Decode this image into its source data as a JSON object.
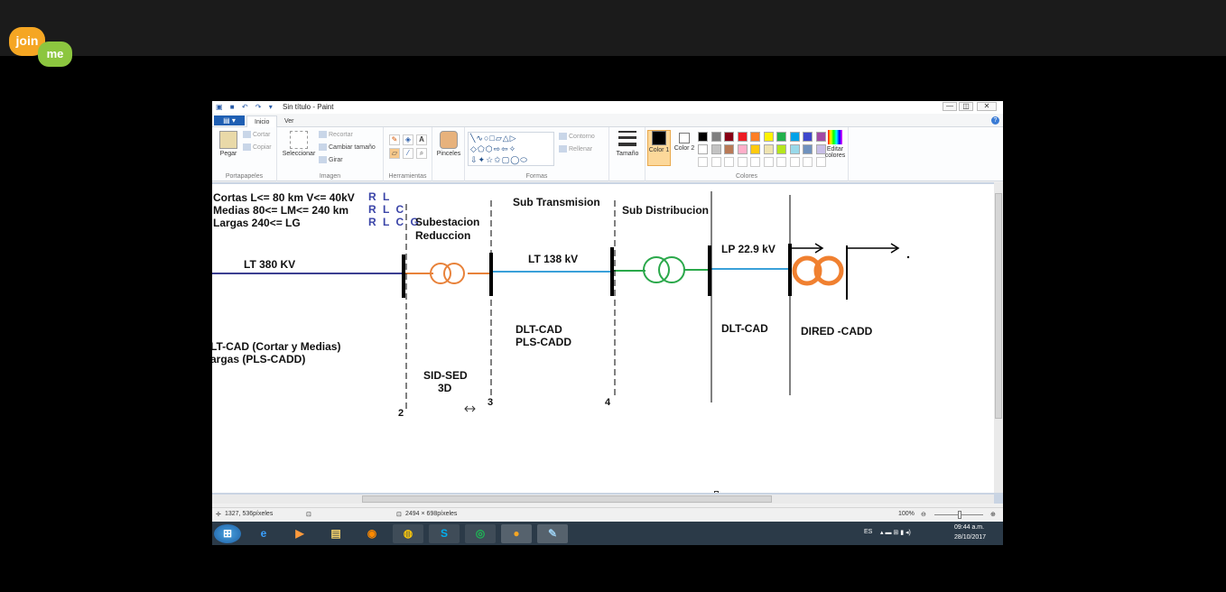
{
  "joinme": {
    "join": "join",
    "me": "me"
  },
  "window": {
    "title": "Sin título - Paint",
    "min": "—",
    "max": "◫",
    "close": "✕"
  },
  "tabs": {
    "home": "Inicio",
    "view": "Ver"
  },
  "ribbon": {
    "paste": "Pegar",
    "cut": "Cortar",
    "copy": "Copiar",
    "clipboard": "Portapapeles",
    "select": "Seleccionar",
    "crop": "Recortar",
    "resize": "Cambiar tamaño",
    "rotate": "Girar",
    "image": "Imagen",
    "tools": "Herramientas",
    "brushes": "Pinceles",
    "outline": "Contorno",
    "fill": "Rellenar",
    "shapes": "Formas",
    "size": "Tamaño",
    "color1": "Color 1",
    "color2": "Color 2",
    "edit_colors": "Editar colores",
    "colors": "Colores"
  },
  "palette": {
    "row1": [
      "#000000",
      "#7f7f7f",
      "#880015",
      "#ed1c24",
      "#ff7f27",
      "#fff200",
      "#22b14c",
      "#00a2e8",
      "#3f48cc",
      "#a349a4"
    ],
    "row2": [
      "#ffffff",
      "#c3c3c3",
      "#b97a57",
      "#ffaec9",
      "#ffc90e",
      "#efe4b0",
      "#b5e61d",
      "#99d9ea",
      "#7092be",
      "#c8bfe7"
    ],
    "row3": [
      "#ffffff",
      "#ffffff",
      "#ffffff",
      "#ffffff",
      "#ffffff",
      "#ffffff",
      "#ffffff",
      "#ffffff",
      "#ffffff",
      "#ffffff"
    ],
    "color1": "#000000",
    "color2": "#ffffff"
  },
  "canvas": {
    "cortas": "Cortas   L<= 80 km  V<= 40kV",
    "medias": "Medias      80<= LM<= 240 km",
    "largas": "Largas      240<= LG",
    "rl": "R L",
    "rlc1": "R L C",
    "rlcg": "R L C G",
    "subestacion": "Subestacion",
    "reduccion": "Reduccion",
    "sub_transmision": "Sub Transmision",
    "sub_distribucion": "Sub Distribucion",
    "lt380": "LT 380 KV",
    "lt138": "LT 138 kV",
    "lp229": "LP 22.9 kV",
    "ltcad": "LT-CAD (Cortar y Medias)",
    "largas_pls": "argas (PLS-CADD)",
    "sidsed": "SID-SED",
    "threed": "3D",
    "dltcad1": "DLT-CAD",
    "plscadd": "PLS-CADD",
    "dltcad2": "DLT-CAD",
    "diredcadd": "DIRED -CADD",
    "n2": "2",
    "n3": "3",
    "n4": "4"
  },
  "status": {
    "coords": "1327, 536píxeles",
    "size": "2494 × 698píxeles",
    "zoom": "100%"
  },
  "tray": {
    "lang": "ES",
    "time": "09:44 a.m.",
    "date": "28/10/2017"
  }
}
